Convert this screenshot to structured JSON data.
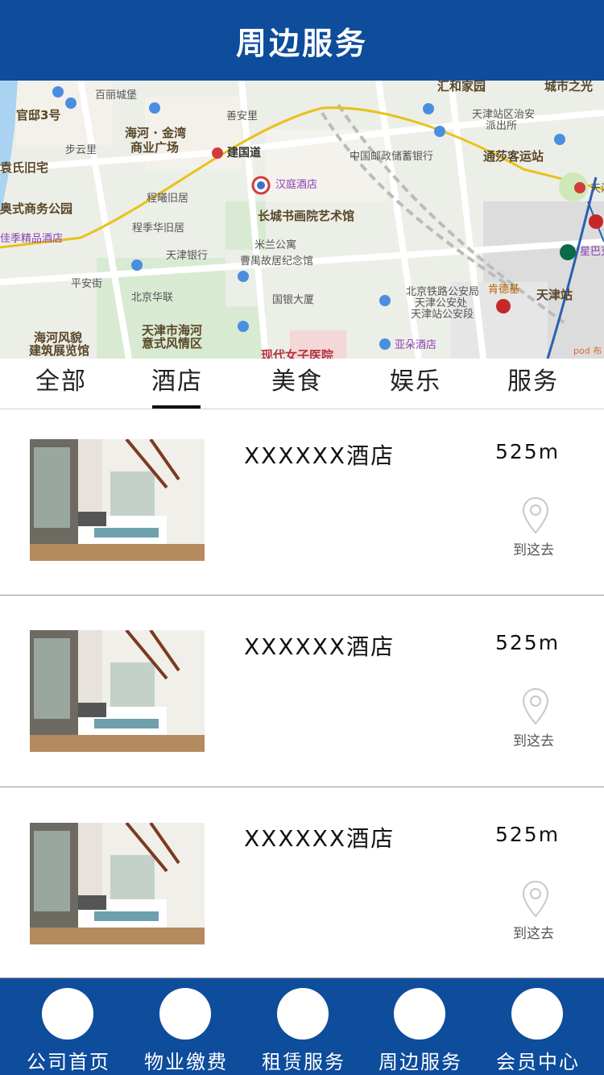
{
  "header": {
    "title": "周边服务"
  },
  "map": {
    "labels": {
      "huiheyuan": "汇和家园",
      "chengshi": "城市之光",
      "guanxing": "官邸3号",
      "bailicheng": "百丽城堡",
      "tianjinzhan_police": "天津站区治安",
      "paichusuo": "派出所",
      "haihe1": "海河 · 金湾",
      "haihe2": "商业广场",
      "shanan": "善安里",
      "jianguodao": "建国道",
      "bujing": "步云里",
      "yuanshi": "袁氏旧宅",
      "postal": "中国邮政储蓄银行",
      "tongsha": "通莎客运站",
      "hanting": "汉庭酒店",
      "changcheng": "长城书画院艺术馆",
      "chenghui": "程曦旧居",
      "aoshi": "奥式商务公园",
      "jingpin": "佳季精品酒店",
      "chengji": "程季华旧居",
      "tianjinbank": "天津银行",
      "milan": "米兰公寓",
      "caoyu": "曹禺故居纪念馆",
      "xingba": "星巴克",
      "pingan": "平安街",
      "beijinghl": "北京华联",
      "guoyin": "国银大厦",
      "police1": "北京铁路公安局",
      "police2": "天津公安处",
      "police3": "天津站公安段",
      "kfc": "肯德基",
      "tjzhan": "天津站",
      "haihe_fm1": "海河风貌",
      "haihe_fm2": "建筑展览馆",
      "tjfq1": "天津市海河",
      "tjfq2": "意式风情区",
      "yaduo": "亚朵酒店",
      "nvzi": "现代女子医院",
      "tianjin_edge": "天津",
      "pod": "pod 布"
    }
  },
  "tabs": [
    {
      "label": "全部"
    },
    {
      "label": "酒店"
    },
    {
      "label": "美食"
    },
    {
      "label": "娱乐"
    },
    {
      "label": "服务"
    }
  ],
  "active_tab": "酒店",
  "list": [
    {
      "name": "XXXXXX酒店",
      "distance": "525m",
      "goto": "到这去"
    },
    {
      "name": "XXXXXX酒店",
      "distance": "525m",
      "goto": "到这去"
    },
    {
      "name": "XXXXXX酒店",
      "distance": "525m",
      "goto": "到这去"
    }
  ],
  "nav": [
    {
      "label": "公司首页"
    },
    {
      "label": "物业缴费"
    },
    {
      "label": "租赁服务"
    },
    {
      "label": "周边服务"
    },
    {
      "label": "会员中心"
    }
  ],
  "colors": {
    "brand": "#0e4c9c"
  }
}
